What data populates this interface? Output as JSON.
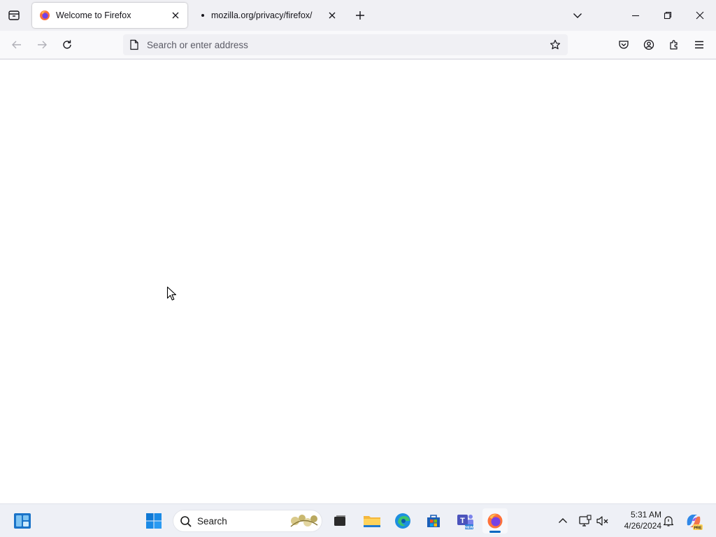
{
  "tabs": [
    {
      "title": "Welcome to Firefox",
      "active": true,
      "icon": "firefox-icon"
    },
    {
      "title": "mozilla.org/privacy/firefox/",
      "active": false,
      "icon": "loading-dot-icon"
    }
  ],
  "navbar": {
    "address_placeholder": "Search or enter address",
    "address_value": ""
  },
  "taskbar": {
    "search_label": "Search",
    "time": "5:31 AM",
    "date": "4/26/2024"
  },
  "colors": {
    "tabstrip_bg": "#f0f0f4",
    "accent_blue": "#0067c0",
    "firefox_orange": "#ff7139"
  }
}
